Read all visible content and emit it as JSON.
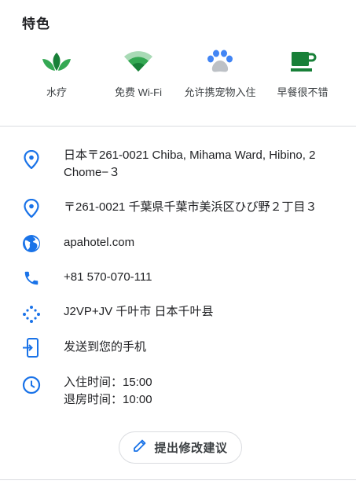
{
  "section": {
    "title": "特色"
  },
  "features": [
    {
      "label": "水疗",
      "icon": "spa-leaves-icon"
    },
    {
      "label": "免费 Wi-Fi",
      "icon": "wifi-icon"
    },
    {
      "label": "允许携宠物入住",
      "icon": "pet-paw-icon"
    },
    {
      "label": "早餐很不错",
      "icon": "coffee-cup-icon"
    }
  ],
  "details": {
    "address_en": "日本〒261-0021 Chiba, Mihama Ward, Hibino, 2 Chome−３",
    "address_ja": "〒261-0021 千葉県千葉市美浜区ひび野２丁目３",
    "website": "apahotel.com",
    "phone": "+81 570-070-111",
    "plus_code": "J2VP+JV 千叶市 日本千叶县",
    "send_to_phone": "发送到您的手机",
    "checkin": "入住时间：15:00",
    "checkout": "退房时间：10:00"
  },
  "actions": {
    "suggest_edit": "提出修改建议"
  },
  "colors": {
    "accent_blue": "#1a73e8",
    "leaf_green": "#188038",
    "paw_blue": "#4285f4",
    "divider": "#dadce0"
  }
}
